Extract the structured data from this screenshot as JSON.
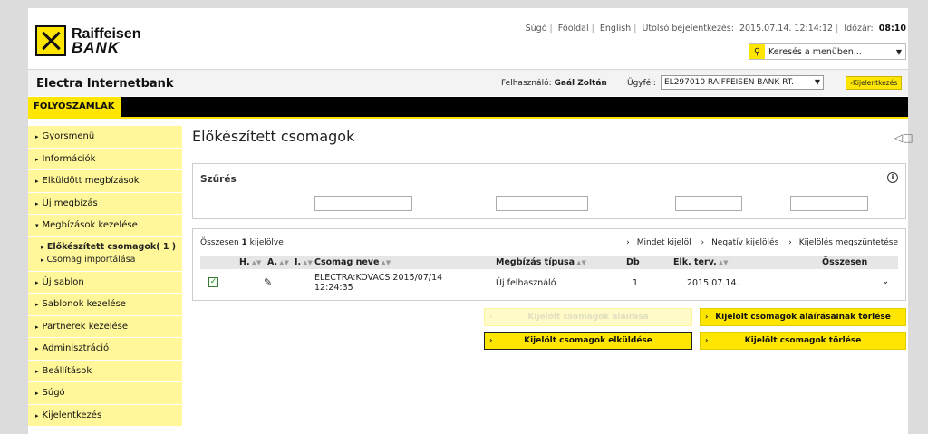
{
  "brand": {
    "line1": "Raiffeisen",
    "line2": "BANK"
  },
  "toplinks": {
    "help": "Súgó",
    "home": "Főoldal",
    "english": "English",
    "last_login_label": "Utolsó bejelentkezés:",
    "last_login_value": "2015.07.14. 12:14:12",
    "timer_label": "Időzár:",
    "timer_value": "08:10"
  },
  "search": {
    "placeholder": "Keresés a menüben..."
  },
  "app": {
    "title": "Electra Internetbank"
  },
  "user": {
    "label": "Felhasználó:",
    "name": "Gaál Zoltán"
  },
  "client": {
    "label": "Ügyfél:",
    "value": "EL297010 RAIFFEISEN BANK RT."
  },
  "logout_label": "Kijelentkezés",
  "tab_label": "FOLYÓSZÁMLÁK",
  "sidebar": {
    "items": [
      "Gyorsmenü",
      "Információk",
      "Elküldött megbízások",
      "Új megbízás",
      "Megbízások kezelése",
      "Új sablon",
      "Sablonok kezelése",
      "Partnerek kezelése",
      "Adminisztráció",
      "Beállítások",
      "Súgó",
      "Kijelentkezés"
    ],
    "sub_items": [
      "Előkészített csomagok( 1 )",
      "Csomag importálása"
    ]
  },
  "main": {
    "title": "Előkészített csomagok"
  },
  "filter": {
    "title": "Szűrés"
  },
  "results": {
    "count_prefix": "Összesen",
    "count_value": "1",
    "count_suffix": "kijelölve",
    "select_all": "Mindet kijelöl",
    "invert": "Negatív kijelölés",
    "clear": "Kijelölés megszüntetése"
  },
  "table": {
    "headers": {
      "h": "H.",
      "a": "A.",
      "i": "I.",
      "name": "Csomag neve",
      "type": "Megbízás típusa",
      "db": "Db",
      "date": "Elk. terv.",
      "total": "Összesen"
    },
    "rows": [
      {
        "name_line1": "ELECTRA:KOVACS 2015/07/14",
        "name_line2": "12:24:35",
        "type": "Új felhasználó",
        "db": "1",
        "date": "2015.07.14."
      }
    ]
  },
  "buttons": {
    "sign": "Kijelölt csomagok aláírása",
    "delete_signatures": "Kijelölt csomagok aláírásainak törlése",
    "send": "Kijelölt csomagok elküldése",
    "delete": "Kijelölt csomagok törlése"
  }
}
